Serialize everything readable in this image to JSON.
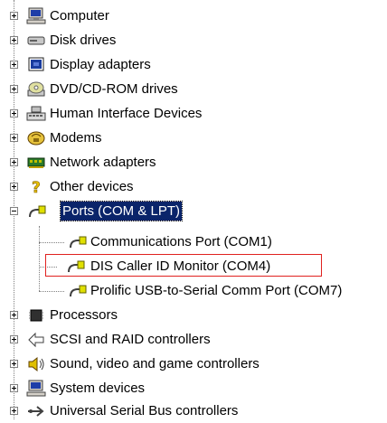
{
  "tree": {
    "items": [
      {
        "label": "Computer",
        "icon": "computer-icon",
        "expanded": false
      },
      {
        "label": "Disk drives",
        "icon": "disk-drive-icon",
        "expanded": false
      },
      {
        "label": "Display adapters",
        "icon": "display-adapter-icon",
        "expanded": false
      },
      {
        "label": "DVD/CD-ROM drives",
        "icon": "cdrom-icon",
        "expanded": false
      },
      {
        "label": "Human Interface Devices",
        "icon": "hid-icon",
        "expanded": false
      },
      {
        "label": "Modems",
        "icon": "modem-icon",
        "expanded": false
      },
      {
        "label": "Network adapters",
        "icon": "network-adapter-icon",
        "expanded": false
      },
      {
        "label": "Other devices",
        "icon": "unknown-device-icon",
        "expanded": false
      },
      {
        "label": "Ports (COM & LPT)",
        "icon": "port-icon",
        "expanded": true,
        "selected": true,
        "children": [
          {
            "label": "Communications Port (COM1)",
            "icon": "port-icon"
          },
          {
            "label": "DIS Caller ID Monitor (COM4)",
            "icon": "port-icon",
            "highlighted": true
          },
          {
            "label": "Prolific USB-to-Serial Comm Port (COM7)",
            "icon": "port-icon"
          }
        ]
      },
      {
        "label": "Processors",
        "icon": "processor-icon",
        "expanded": false
      },
      {
        "label": "SCSI and RAID controllers",
        "icon": "scsi-icon",
        "expanded": false
      },
      {
        "label": "Sound, video and game controllers",
        "icon": "sound-icon",
        "expanded": false
      },
      {
        "label": "System devices",
        "icon": "system-device-icon",
        "expanded": false
      },
      {
        "label": "Universal Serial Bus controllers",
        "icon": "usb-icon",
        "expanded": false
      }
    ]
  },
  "colors": {
    "selection_bg": "#0a246a",
    "highlight_border": "#e0211f",
    "tree_lines": "#808080"
  }
}
